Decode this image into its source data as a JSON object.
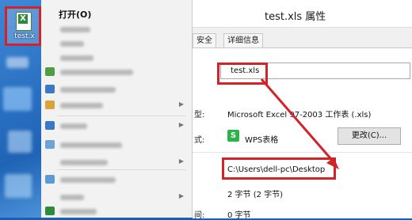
{
  "desktop": {
    "file_icon_label": "test.x",
    "file_icon_glyph": "X"
  },
  "context_menu": {
    "open_label": "打开(O)"
  },
  "dialog": {
    "title": "test.xls 属性",
    "tabs": [
      "安全",
      "详细信息"
    ],
    "file_name": "test.xls",
    "type_label": "型:",
    "type_value": "Microsoft Excel 97-2003 工作表 (.xls)",
    "open_with_label": "式:",
    "open_with_icon": "S",
    "open_with_value": "WPS表格",
    "change_button": "更改(C)...",
    "location_value": "C:\\Users\\dell-pc\\Desktop",
    "size_value": "2 字节 (2 字节)",
    "disk_size_label": "间:",
    "disk_size_value": "0 字节"
  },
  "colors": {
    "highlight_red": "#d2232a",
    "excel_green": "#2e8b3a",
    "wps_green": "#2db24a"
  }
}
